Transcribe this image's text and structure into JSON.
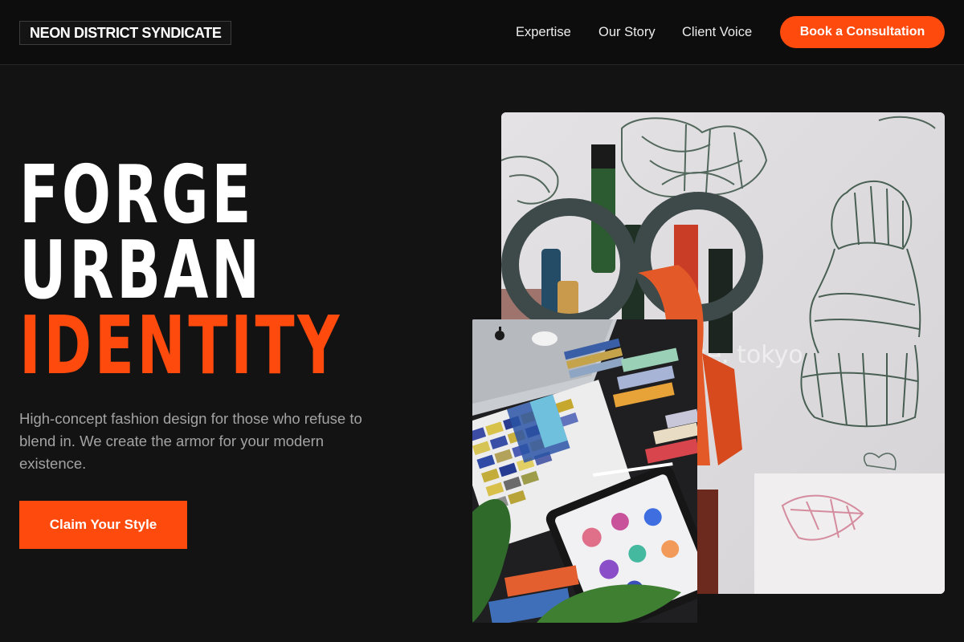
{
  "header": {
    "logo": "NEON DISTRICT SYNDICATE",
    "nav": [
      "Expertise",
      "Our Story",
      "Client Voice"
    ],
    "cta_label": "Book a Consultation"
  },
  "hero": {
    "headline_lines": [
      "FORGE",
      "URBAN",
      "IDENTITY"
    ],
    "subcopy": "High-concept fashion design for those who refuse to blend in. We create the armor for your modern existence.",
    "cta_label": "Claim Your Style",
    "photo_watermark": "se. tokyo"
  },
  "colors": {
    "accent": "#ff4a0d",
    "background": "#131313",
    "header_background": "#0d0d0d",
    "text": "#ffffff",
    "muted_text": "#a3a3a3"
  },
  "icons": [
    "apple-logo-icon"
  ]
}
